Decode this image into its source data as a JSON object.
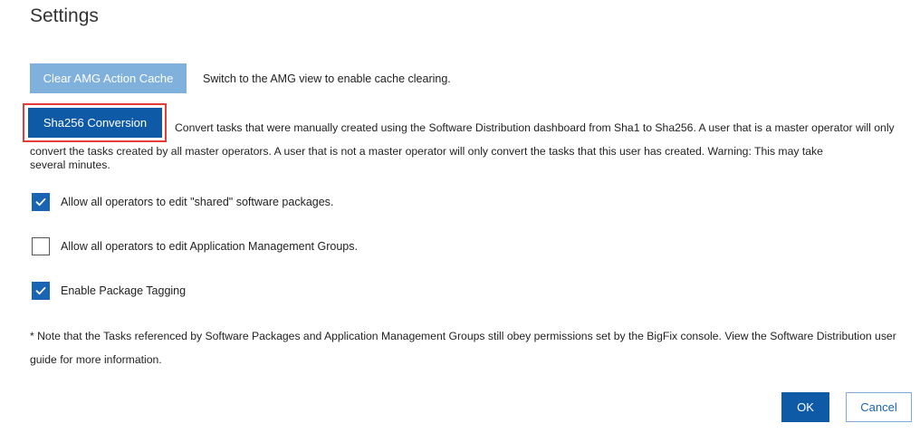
{
  "page": {
    "title": "Settings"
  },
  "amg": {
    "clear_button_label": "Clear AMG Action Cache",
    "clear_button_enabled": false,
    "note": "Switch to the AMG view to enable cache clearing."
  },
  "sha": {
    "button_label": "Sha256 Conversion",
    "highlighted": true,
    "description": "Convert tasks that were manually created using the Software Distribution dashboard from Sha1 to Sha256. A user that is a master operator will only convert the tasks created by all master operators. A user that is not a master operator will only convert the tasks that this user has created. Warning: This may take",
    "description_tail": "several minutes."
  },
  "options": [
    {
      "label": "Allow all operators to edit \"shared\" software packages.",
      "checked": true
    },
    {
      "label": "Allow all operators to edit Application Management Groups.",
      "checked": false
    },
    {
      "label": "Enable Package Tagging",
      "checked": true
    }
  ],
  "footnote": "* Note that the Tasks referenced by Software Packages and Application Management Groups still obey permissions set by the BigFix console. View the Software Distribution user guide for more information.",
  "actions": {
    "ok_label": "OK",
    "cancel_label": "Cancel"
  },
  "colors": {
    "primary": "#0f5aa6",
    "disabled_primary": "#7fb1dc",
    "highlight_border": "#e43b3b",
    "checkbox_checked": "#1a65b3"
  },
  "icons": {
    "checkmark": "checkmark-icon"
  }
}
